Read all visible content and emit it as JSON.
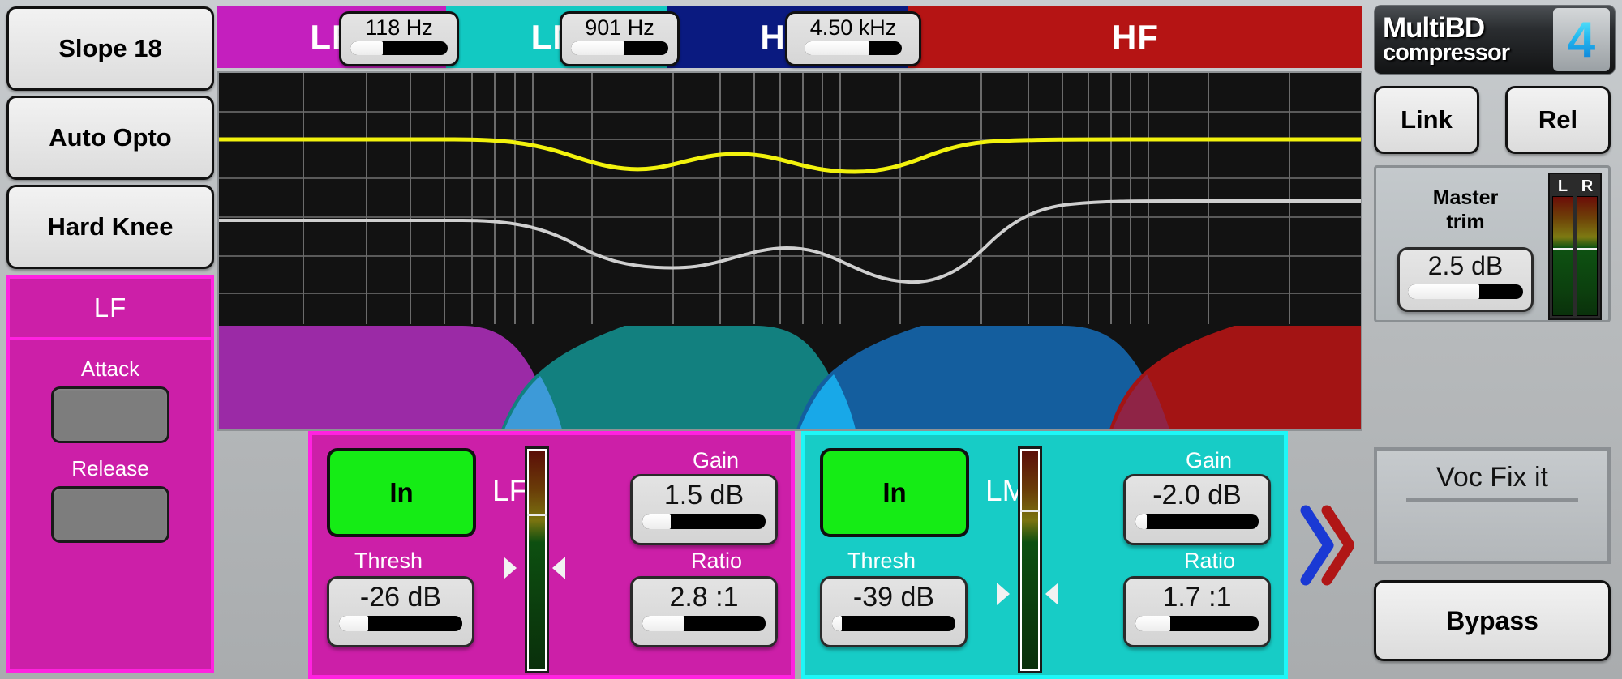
{
  "app": {
    "logo_line1": "MultiBD",
    "logo_line2": "compressor",
    "logo_number": "4"
  },
  "left_panel": {
    "slope_button": "Slope 18",
    "mode_button": "Auto Opto",
    "knee_button": "Hard Knee",
    "selected_band": "LF",
    "attack_label": "Attack",
    "release_label": "Release"
  },
  "band_header": {
    "bands": [
      {
        "label": "LF",
        "color": "#c41fbe"
      },
      {
        "label": "LM",
        "color": "#12c9c2"
      },
      {
        "label": "HM",
        "color": "#0a1a80"
      },
      {
        "label": "HF",
        "color": "#b51414"
      }
    ],
    "crossovers": [
      {
        "value": "118 Hz",
        "fill_pct": 33
      },
      {
        "value": "901 Hz",
        "fill_pct": 55
      },
      {
        "value": "4.50 kHz",
        "fill_pct": 67
      }
    ]
  },
  "graph": {
    "band_fill_colors": [
      "#9b2aa6",
      "#12807f",
      "#145e9e",
      "#a31414"
    ],
    "overlap_colors": [
      "#3d9ad8",
      "#18a8e8",
      "#8f2446"
    ],
    "curve_output_color": "#f2f20d",
    "curve_input_color": "#cfcfcf"
  },
  "bands": [
    {
      "id": "lf",
      "name": "LF",
      "in_label": "In",
      "thresh_label": "Thresh",
      "thresh_value": "-26 dB",
      "thresh_fill_pct": 24,
      "gain_label": "Gain",
      "gain_value": "1.5 dB",
      "gain_fill_pct": 23,
      "ratio_label": "Ratio",
      "ratio_value": "2.8 :1",
      "ratio_fill_pct": 34,
      "meter_marker_pct": 29,
      "accent": "#ff22e0",
      "bg": "#cc1fa8"
    },
    {
      "id": "lm",
      "name": "LM",
      "in_label": "In",
      "thresh_label": "Thresh",
      "thresh_value": "-39 dB",
      "thresh_fill_pct": 8,
      "gain_label": "Gain",
      "gain_value": "-2.0 dB",
      "gain_fill_pct": 9,
      "ratio_label": "Ratio",
      "ratio_value": "1.7 :1",
      "ratio_fill_pct": 28,
      "meter_marker_pct": 27,
      "accent": "#1ef7f7",
      "bg": "#17ccc6"
    }
  ],
  "right_panel": {
    "link_button": "Link",
    "rel_button": "Rel",
    "master_title": "Master\ntrim",
    "master_title_line1": "Master",
    "master_title_line2": "trim",
    "master_value": "2.5 dB",
    "master_fill_pct": 62,
    "meter_left_label": "L",
    "meter_right_label": "R",
    "preset_name": "Voc Fix it",
    "bypass_button": "Bypass"
  },
  "nav": {
    "next_chevron_blue": "#1a39d4",
    "next_chevron_red": "#b01616"
  }
}
